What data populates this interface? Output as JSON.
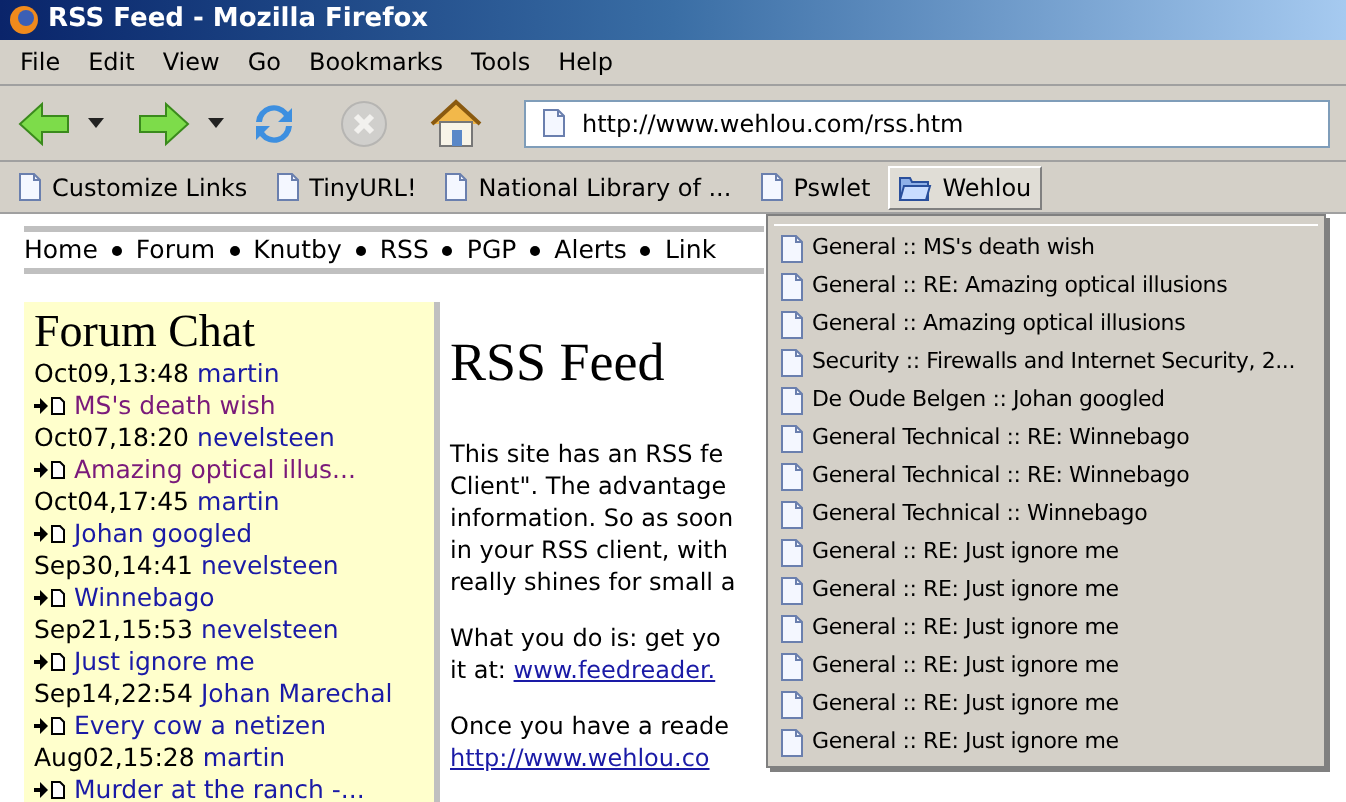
{
  "window": {
    "title": "RSS Feed - Mozilla Firefox"
  },
  "menu": [
    "File",
    "Edit",
    "View",
    "Go",
    "Bookmarks",
    "Tools",
    "Help"
  ],
  "toolbar": {
    "url": "http://www.wehlou.com/rss.htm",
    "stop_disabled": true
  },
  "bookmarks": [
    {
      "kind": "page",
      "label": "Customize Links",
      "selected": false
    },
    {
      "kind": "page",
      "label": "TinyURL!",
      "selected": false
    },
    {
      "kind": "page",
      "label": "National Library of ...",
      "selected": false
    },
    {
      "kind": "page",
      "label": "Pswlet",
      "selected": false
    },
    {
      "kind": "folder",
      "label": "Wehlou",
      "selected": true
    }
  ],
  "dropdown": [
    "General :: MS's death wish",
    "General :: RE: Amazing optical illusions",
    "General :: Amazing optical illusions",
    "Security :: Firewalls and Internet Security, 2...",
    "De Oude Belgen :: Johan googled",
    "General Technical :: RE: Winnebago",
    "General Technical :: RE: Winnebago",
    "General Technical :: Winnebago",
    "General :: RE: Just ignore me",
    "General :: RE: Just ignore me",
    "General :: RE: Just ignore me",
    "General :: RE: Just ignore me",
    "General :: RE: Just ignore me",
    "General :: RE: Just ignore me"
  ],
  "nav": [
    "Home",
    "Forum",
    "Knutby",
    "RSS",
    "PGP",
    "Alerts",
    "Link"
  ],
  "sidebar": {
    "title": "Forum Chat",
    "entries": [
      {
        "time": "Oct09,13:48",
        "user": "martin",
        "topic": "MS's death wish",
        "visited": true
      },
      {
        "time": "Oct07,18:20",
        "user": "nevelsteen",
        "topic": "Amazing optical illus...",
        "visited": true
      },
      {
        "time": "Oct04,17:45",
        "user": "martin",
        "topic": "Johan googled",
        "visited": false
      },
      {
        "time": "Sep30,14:41",
        "user": "nevelsteen",
        "topic": "Winnebago",
        "visited": false
      },
      {
        "time": "Sep21,15:53",
        "user": "nevelsteen",
        "topic": "Just ignore me",
        "visited": false
      },
      {
        "time": "Sep14,22:54",
        "user": "Johan Marechal",
        "topic": "Every cow a netizen",
        "visited": false
      },
      {
        "time": "Aug02,15:28",
        "user": "martin",
        "topic": "Murder at the ranch -...",
        "visited": false
      }
    ]
  },
  "main": {
    "heading": "RSS Feed",
    "paragraphs": [
      {
        "lines": [
          {
            "text": "This site has an RSS fe"
          },
          {
            "text": "Client\". The advantage"
          },
          {
            "text": "information. So as soon"
          },
          {
            "text": "in your RSS client, with"
          },
          {
            "text": "really shines for small a"
          }
        ]
      },
      {
        "lines": [
          {
            "text": "What you do is: get yo"
          },
          {
            "text": "it at: ",
            "link": "www.feedreader."
          }
        ]
      },
      {
        "lines": [
          {
            "text": "Once you have a reade"
          },
          {
            "link": "http://www.wehlou.co"
          }
        ]
      }
    ]
  }
}
